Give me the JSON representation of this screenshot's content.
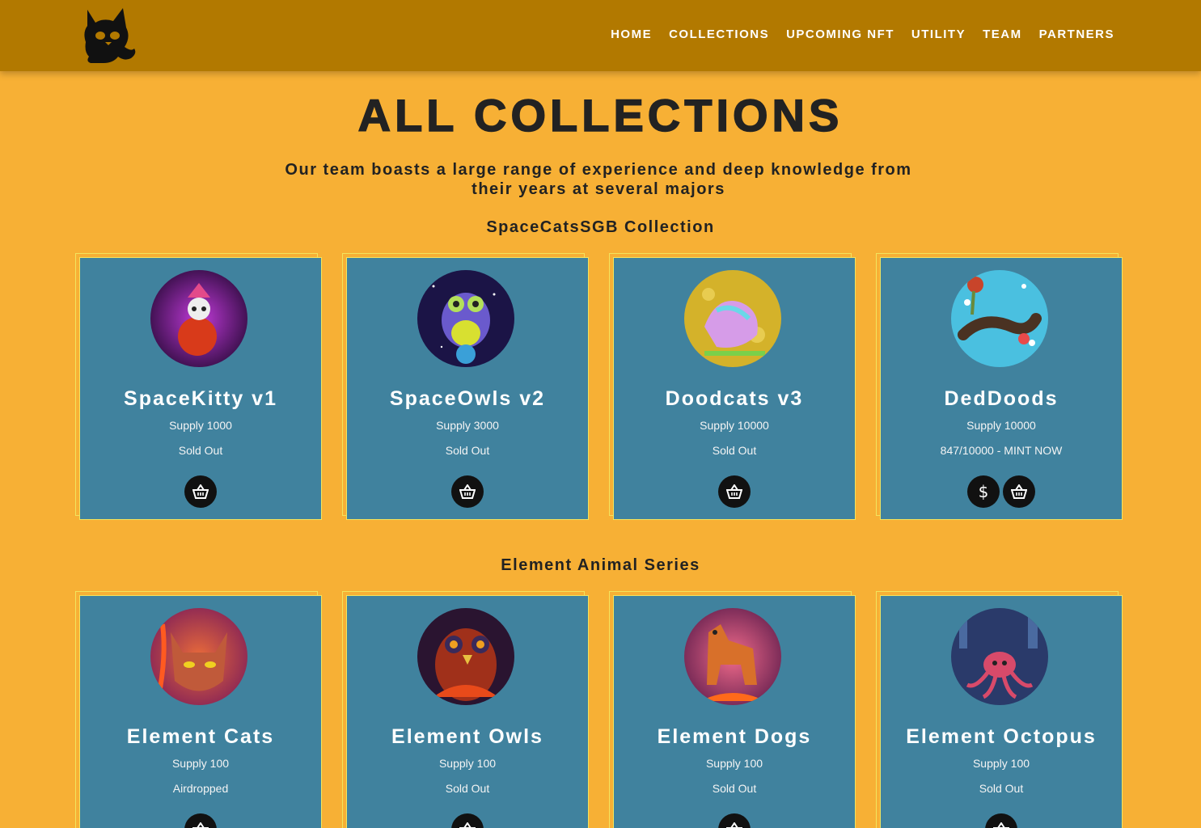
{
  "nav": {
    "logo_icon": "cat-logo-icon",
    "links": [
      "HOME",
      "COLLECTIONS",
      "UPCOMING NFT",
      "UTILITY",
      "TEAM",
      "PARTNERS"
    ]
  },
  "page": {
    "title": "ALL COLLECTIONS",
    "subtitle": "Our team boasts a large range of experience and deep knowledge from their years at several majors"
  },
  "sections": [
    {
      "title": "SpaceCatsSGB Collection",
      "cards": [
        {
          "name": "SpaceKitty v1",
          "supply": "Supply 1000",
          "status": "Sold Out",
          "buttons": [
            "basket-icon"
          ]
        },
        {
          "name": "SpaceOwls v2",
          "supply": "Supply 3000",
          "status": "Sold Out",
          "buttons": [
            "basket-icon"
          ]
        },
        {
          "name": "Doodcats v3",
          "supply": "Supply 10000",
          "status": "Sold Out",
          "buttons": [
            "basket-icon"
          ]
        },
        {
          "name": "DedDoods",
          "supply": "Supply 10000",
          "status": "847/10000 - MINT NOW",
          "buttons": [
            "dollar-icon",
            "basket-icon"
          ],
          "dollar_symbol": "$"
        }
      ]
    },
    {
      "title": "Element Animal Series",
      "cards": [
        {
          "name": "Element Cats",
          "supply": "Supply 100",
          "status": "Airdropped",
          "buttons": [
            "basket-icon"
          ]
        },
        {
          "name": "Element Owls",
          "supply": "Supply 100",
          "status": "Sold Out",
          "buttons": [
            "basket-icon"
          ]
        },
        {
          "name": "Element Dogs",
          "supply": "Supply 100",
          "status": "Sold Out",
          "buttons": [
            "basket-icon"
          ]
        },
        {
          "name": "Element Octopus",
          "supply": "Supply 100",
          "status": "Sold Out",
          "buttons": [
            "basket-icon"
          ]
        }
      ]
    }
  ],
  "colors": {
    "page_bg": "#f7b035",
    "navbar_bg": "#b27900",
    "card_bg": "#40829e",
    "card_border": "#f2e45e"
  }
}
